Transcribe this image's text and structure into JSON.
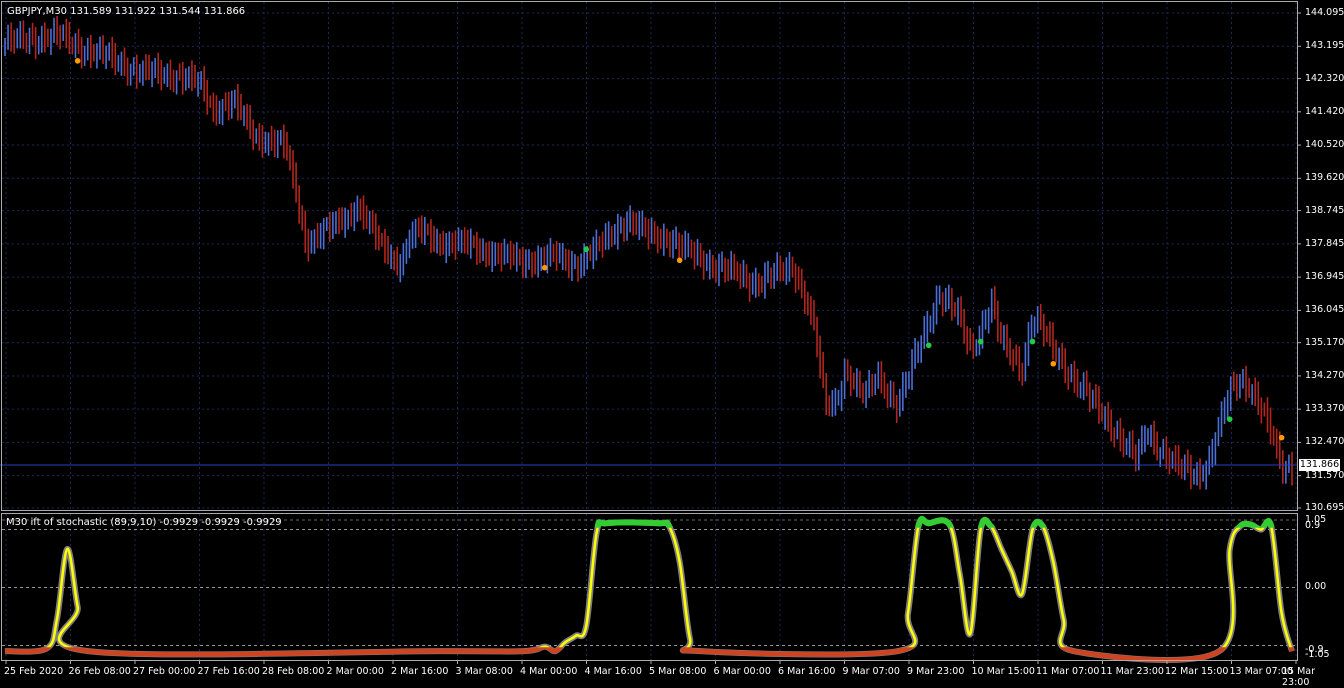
{
  "chart_header": "GBPJPY,M30  131.589 131.922 131.544 131.866",
  "indicator_header": "M30 ift of stochastic (89,9,10) -0.9929 -0.9929 -0.9929",
  "current_price_label": "131.866",
  "colors": {
    "background": "#000000",
    "grid": "#1a2a5a",
    "bull_bar": "#4b6fd6",
    "bear_bar": "#b3261e",
    "signal_green": "#22cc44",
    "signal_orange": "#ff9900",
    "indicator_main": "#ffff00",
    "indicator_outline": "#808080",
    "indicator_top": "#33cc33",
    "indicator_bottom": "#cc4422",
    "axis_text": "#ffffff"
  },
  "price_axis": [
    "144.095",
    "143.195",
    "142.320",
    "141.420",
    "140.520",
    "139.620",
    "138.745",
    "137.845",
    "136.945",
    "136.045",
    "135.170",
    "134.270",
    "133.370",
    "132.470",
    "131.570",
    "130.695"
  ],
  "indicator_axis": [
    "1.05",
    "0.9",
    "0.00",
    "-0.9",
    "-1.05"
  ],
  "time_axis": [
    "25 Feb 2020",
    "26 Feb 08:00",
    "27 Feb 00:00",
    "27 Feb 16:00",
    "28 Feb 08:00",
    "2 Mar 00:00",
    "2 Mar 16:00",
    "3 Mar 08:00",
    "4 Mar 00:00",
    "4 Mar 16:00",
    "5 Mar 08:00",
    "6 Mar 00:00",
    "6 Mar 16:00",
    "9 Mar 07:00",
    "9 Mar 23:00",
    "10 Mar 15:00",
    "11 Mar 07:00",
    "11 Mar 23:00",
    "12 Mar 15:00",
    "13 Mar 07:00",
    "15 Mar 23:00"
  ],
  "chart_data": [
    {
      "type": "line",
      "title": "GBPJPY,M30",
      "ylim": [
        130.695,
        144.095
      ],
      "close_path": [
        [
          0,
          143.3
        ],
        [
          5,
          143.5
        ],
        [
          7,
          143.2
        ],
        [
          10,
          142.9
        ],
        [
          13,
          142.5
        ],
        [
          17,
          142.4
        ],
        [
          19,
          142.1
        ],
        [
          20,
          141.5
        ],
        [
          22,
          141.7
        ],
        [
          24,
          140.8
        ],
        [
          27,
          140.5
        ],
        [
          28,
          139.3
        ],
        [
          29,
          137.9
        ],
        [
          31,
          138.2
        ],
        [
          33,
          138.6
        ],
        [
          34,
          138.9
        ],
        [
          36,
          137.9
        ],
        [
          38,
          137.3
        ],
        [
          39,
          138.0
        ],
        [
          40,
          138.2
        ],
        [
          42,
          137.9
        ],
        [
          45,
          137.8
        ],
        [
          46,
          137.7
        ],
        [
          48,
          137.5
        ],
        [
          50,
          137.4
        ],
        [
          53,
          137.5
        ],
        [
          55,
          137.3
        ],
        [
          57,
          137.7
        ],
        [
          59,
          138.3
        ],
        [
          60,
          138.5
        ],
        [
          62,
          138.1
        ],
        [
          64,
          138.0
        ],
        [
          66,
          137.6
        ],
        [
          68,
          137.3
        ],
        [
          70,
          137.1
        ],
        [
          72,
          136.8
        ],
        [
          74,
          137.0
        ],
        [
          76,
          137.2
        ],
        [
          77,
          136.5
        ],
        [
          78,
          135.6
        ],
        [
          79,
          133.5
        ],
        [
          80,
          133.5
        ],
        [
          81,
          134.5
        ],
        [
          82,
          134.0
        ],
        [
          83,
          133.7
        ],
        [
          84,
          134.3
        ],
        [
          85,
          133.9
        ],
        [
          86,
          133.5
        ],
        [
          87,
          134.2
        ],
        [
          89,
          135.8
        ],
        [
          90,
          136.5
        ],
        [
          91,
          136.2
        ],
        [
          92,
          135.8
        ],
        [
          93,
          135.0
        ],
        [
          94,
          135.5
        ],
        [
          95,
          136.3
        ],
        [
          96,
          135.2
        ],
        [
          97,
          134.8
        ],
        [
          98,
          134.5
        ],
        [
          99,
          135.9
        ],
        [
          100,
          135.5
        ],
        [
          101,
          135.0
        ],
        [
          103,
          134.2
        ],
        [
          105,
          133.5
        ],
        [
          107,
          132.8
        ],
        [
          109,
          132.0
        ],
        [
          110,
          132.8
        ],
        [
          111,
          132.4
        ],
        [
          113,
          131.8
        ],
        [
          115,
          131.6
        ],
        [
          116,
          132.0
        ],
        [
          117,
          132.9
        ],
        [
          118,
          133.8
        ],
        [
          119,
          134.2
        ],
        [
          120,
          134.0
        ],
        [
          121,
          133.4
        ],
        [
          122,
          132.7
        ],
        [
          123,
          131.8
        ],
        [
          124,
          131.866
        ]
      ],
      "buy_signals": [
        [
          56,
          137.7
        ],
        [
          89,
          135.1
        ],
        [
          94,
          135.2
        ],
        [
          99,
          135.2
        ],
        [
          118,
          133.1
        ]
      ],
      "sell_signals": [
        [
          7,
          142.8
        ],
        [
          52,
          137.2
        ],
        [
          65,
          137.4
        ],
        [
          101,
          134.6
        ],
        [
          123,
          132.6
        ]
      ]
    },
    {
      "type": "line",
      "title": "M30 ift of stochastic (89,9,10)",
      "ylim": [
        -1.05,
        1.05
      ],
      "series": [
        {
          "values": [
            [
              0,
              -0.99
            ],
            [
              4,
              -0.95
            ],
            [
              5,
              -0.5
            ],
            [
              6,
              0.6
            ],
            [
              7,
              -0.3
            ],
            [
              8,
              -0.99
            ],
            [
              42,
              -0.99
            ],
            [
              50,
              -0.99
            ],
            [
              52,
              -0.92
            ],
            [
              53,
              -0.99
            ],
            [
              54,
              -0.85
            ],
            [
              55,
              -0.75
            ],
            [
              56,
              -0.6
            ],
            [
              57,
              0.85
            ],
            [
              58,
              1.0
            ],
            [
              63,
              1.0
            ],
            [
              64,
              0.95
            ],
            [
              65,
              0.4
            ],
            [
              66,
              -0.8
            ],
            [
              67,
              -0.99
            ],
            [
              86,
              -0.99
            ],
            [
              87,
              -0.4
            ],
            [
              88,
              0.95
            ],
            [
              89,
              1.0
            ],
            [
              91,
              0.98
            ],
            [
              92,
              0.2
            ],
            [
              93,
              -0.72
            ],
            [
              94,
              0.9
            ],
            [
              95,
              0.95
            ],
            [
              96,
              0.6
            ],
            [
              97,
              0.25
            ],
            [
              98,
              -0.1
            ],
            [
              99,
              0.9
            ],
            [
              100,
              0.95
            ],
            [
              101,
              0.4
            ],
            [
              102,
              -0.5
            ],
            [
              103,
              -0.99
            ],
            [
              117,
              -0.99
            ],
            [
              118,
              0.6
            ],
            [
              119,
              0.95
            ],
            [
              120,
              0.98
            ],
            [
              121,
              0.9
            ],
            [
              122,
              0.95
            ],
            [
              123,
              -0.4
            ],
            [
              124,
              -0.99
            ]
          ]
        }
      ]
    }
  ]
}
